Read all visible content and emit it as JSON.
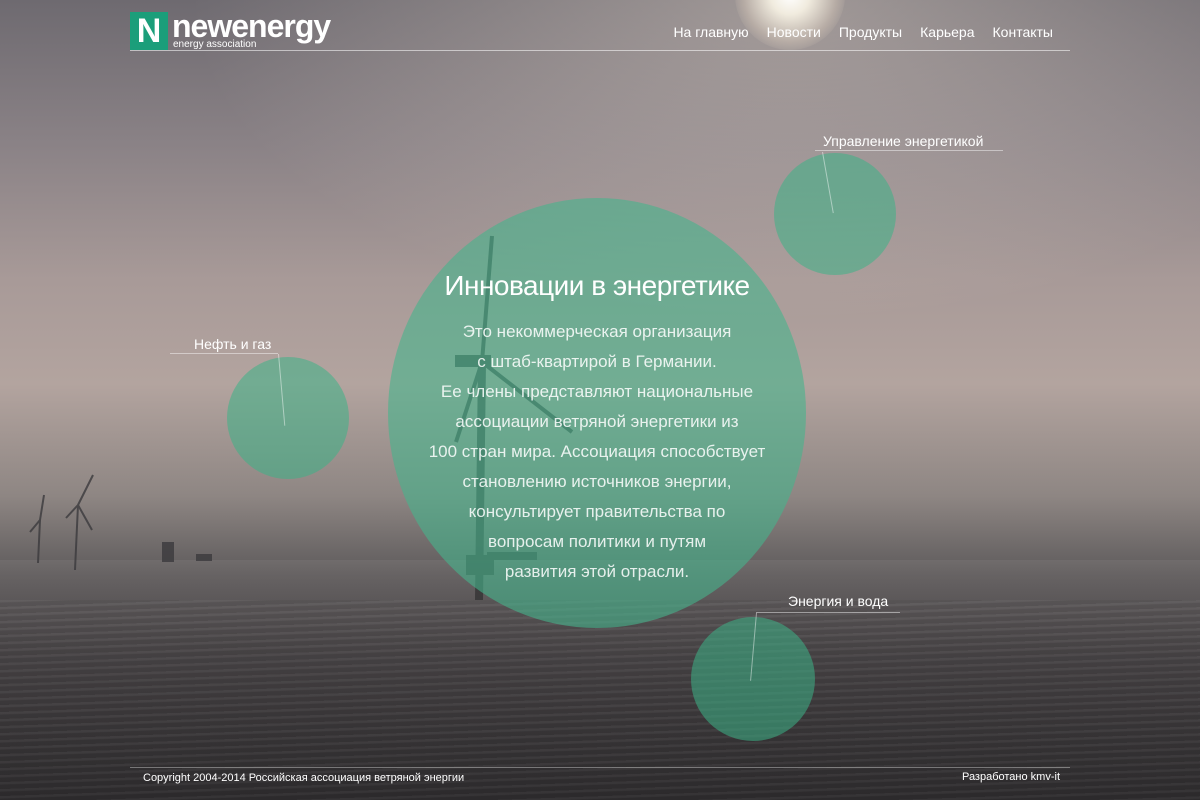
{
  "header": {
    "logo_letter": "N",
    "logo_name": "newenergy",
    "logo_tagline": "energy association",
    "nav": [
      {
        "label": "На главную"
      },
      {
        "label": "Новости"
      },
      {
        "label": "Продукты"
      },
      {
        "label": "Карьера"
      },
      {
        "label": "Контакты"
      }
    ]
  },
  "hero": {
    "title": "Инновации в энергетике",
    "lines": [
      "Это некоммерческая организация",
      "с штаб-квартирой в Германии.",
      "Ее члены представляют национальные",
      "ассоциации ветряной энергетики из",
      "100 стран мира. Ассоциация способствует",
      "становлению источников энергии,",
      "консультирует правительства по",
      "вопросам политики и путям",
      "развития этой отрасли."
    ]
  },
  "topics": [
    {
      "label": "Управление энергетикой"
    },
    {
      "label": "Нефть и газ"
    },
    {
      "label": "Энергия и вода"
    }
  ],
  "footer": {
    "copyright": "Copyright 2004-2014 Российская ассоциация ветряной энергии",
    "credit": "Разработано kmv-it"
  },
  "colors": {
    "accent": "#1b9e7a",
    "bubble": "#3cb287"
  }
}
